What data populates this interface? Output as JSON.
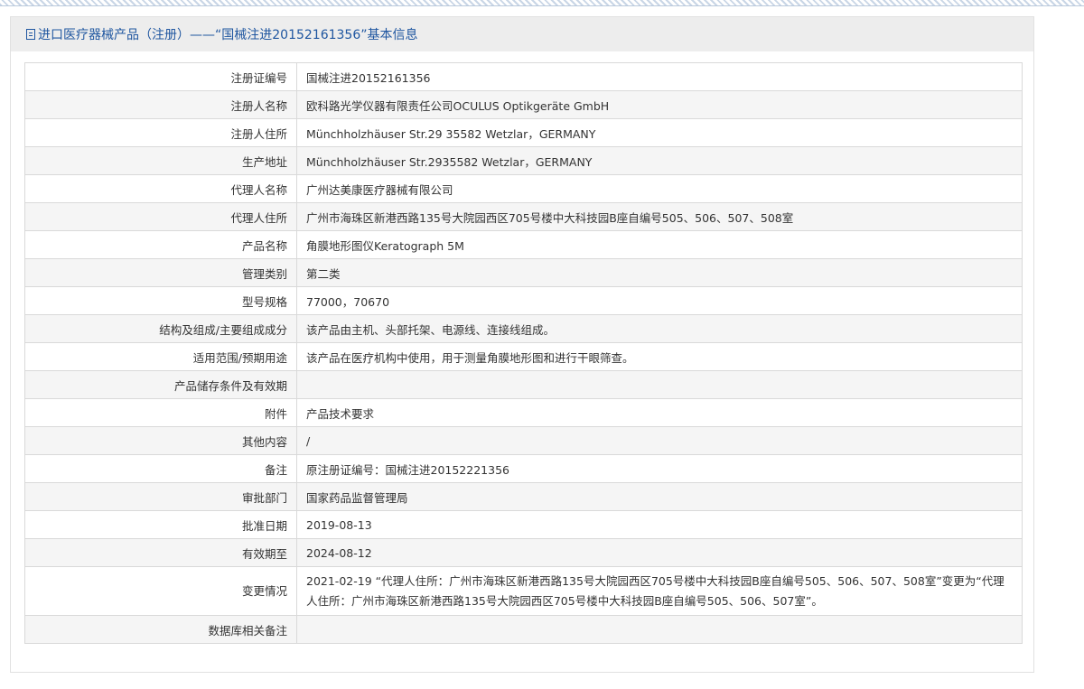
{
  "header": {
    "title": "进口医疗器械产品（注册）——“国械注进20152161356”基本信息"
  },
  "rows": [
    {
      "label": "注册证编号",
      "value": "国械注进20152161356"
    },
    {
      "label": "注册人名称",
      "value": "欧科路光学仪器有限责任公司OCULUS Optikgeräte GmbH"
    },
    {
      "label": "注册人住所",
      "value": "Münchholzhäuser Str.29 35582 Wetzlar，GERMANY"
    },
    {
      "label": "生产地址",
      "value": "Münchholzhäuser Str.2935582 Wetzlar，GERMANY"
    },
    {
      "label": "代理人名称",
      "value": "广州达美康医疗器械有限公司"
    },
    {
      "label": "代理人住所",
      "value": "广州市海珠区新港西路135号大院园西区705号楼中大科技园B座自编号505、506、507、508室"
    },
    {
      "label": "产品名称",
      "value": "角膜地形图仪Keratograph 5M"
    },
    {
      "label": "管理类别",
      "value": "第二类"
    },
    {
      "label": "型号规格",
      "value": "77000，70670"
    },
    {
      "label": "结构及组成/主要组成成分",
      "value": "该产品由主机、头部托架、电源线、连接线组成。"
    },
    {
      "label": "适用范围/预期用途",
      "value": "该产品在医疗机构中使用，用于测量角膜地形图和进行干眼筛查。"
    },
    {
      "label": "产品储存条件及有效期",
      "value": ""
    },
    {
      "label": "附件",
      "value": "产品技术要求"
    },
    {
      "label": "其他内容",
      "value": "/"
    },
    {
      "label": "备注",
      "value": "原注册证编号：国械注进20152221356"
    },
    {
      "label": "审批部门",
      "value": "国家药品监督管理局"
    },
    {
      "label": "批准日期",
      "value": "2019-08-13"
    },
    {
      "label": "有效期至",
      "value": "2024-08-12"
    },
    {
      "label": "变更情况",
      "value": "2021-02-19 “代理人住所：广州市海珠区新港西路135号大院园西区705号楼中大科技园B座自编号505、506、507、508室”变更为“代理人住所：广州市海珠区新港西路135号大院园西区705号楼中大科技园B座自编号505、506、507室”。"
    },
    {
      "label": "数据库相关备注",
      "value": ""
    }
  ]
}
